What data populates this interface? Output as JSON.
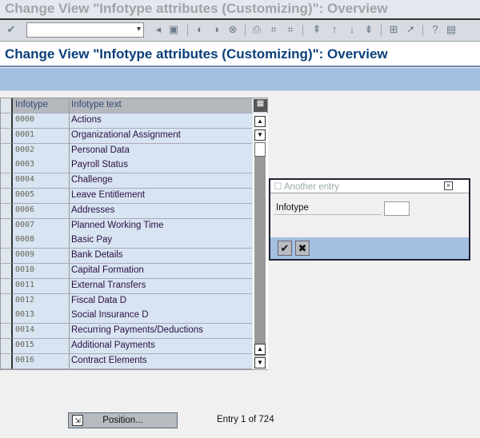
{
  "window_title": "Change View \"Infotype attributes (Customizing)\": Overview",
  "page_title": "Change View \"Infotype attributes (Customizing)\": Overview",
  "toolbar": {
    "command_field": ""
  },
  "table": {
    "headers": [
      "Infotype",
      "Infotype text"
    ],
    "rows": [
      [
        "0000",
        "Actions"
      ],
      [
        "0001",
        "Organizational Assignment"
      ],
      [
        "0002",
        "Personal Data"
      ],
      [
        "0003",
        "Payroll Status"
      ],
      [
        "0004",
        "Challenge"
      ],
      [
        "0005",
        "Leave Entitlement"
      ],
      [
        "0006",
        "Addresses"
      ],
      [
        "0007",
        "Planned Working Time"
      ],
      [
        "0008",
        "Basic Pay"
      ],
      [
        "0009",
        "Bank Details"
      ],
      [
        "0010",
        "Capital Formation"
      ],
      [
        "0011",
        "External Transfers"
      ],
      [
        "0012",
        "Fiscal Data  D"
      ],
      [
        "0013",
        "Social Insurance  D"
      ],
      [
        "0014",
        "Recurring Payments/Deductions"
      ],
      [
        "0015",
        "Additional Payments"
      ],
      [
        "0016",
        "Contract Elements"
      ]
    ]
  },
  "popup": {
    "title": "Another entry",
    "field_label": "Infotype",
    "field_value": ""
  },
  "footer": {
    "position_button": "Position...",
    "entry_text": "Entry 1 of 724"
  }
}
